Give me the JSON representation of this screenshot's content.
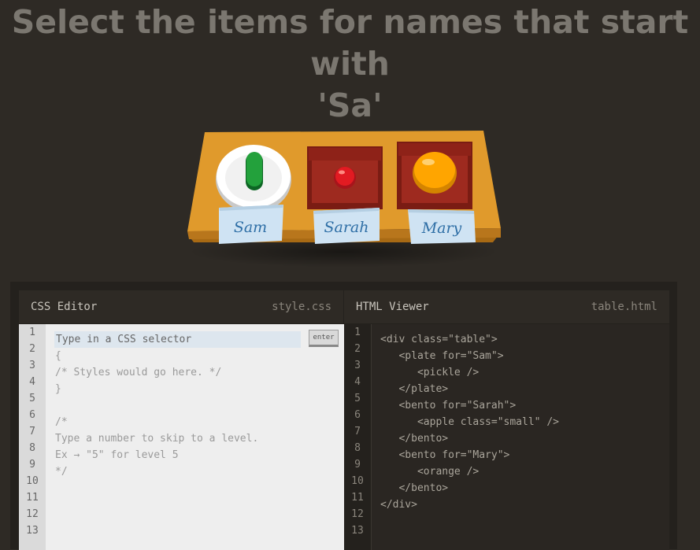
{
  "instruction": {
    "line1": "Select the items for names that start with",
    "line2": "'Sa'"
  },
  "scene": {
    "plates": [
      {
        "owner": "Sam",
        "container": "plate",
        "item": "pickle"
      },
      {
        "owner": "Sarah",
        "container": "bento",
        "item": "apple small"
      },
      {
        "owner": "Mary",
        "container": "bento",
        "item": "orange"
      }
    ],
    "labels": {
      "sam": "Sam",
      "sarah": "Sarah",
      "mary": "Mary"
    }
  },
  "css_editor": {
    "title": "CSS Editor",
    "filename": "style.css",
    "input_placeholder": "Type in a CSS selector",
    "enter_label": "enter",
    "line_numbers": [
      "1",
      "2",
      "3",
      "4",
      "5",
      "6",
      "7",
      "8",
      "9",
      "10",
      "11",
      "12",
      "13"
    ],
    "lines": [
      "",
      "{",
      "/* Styles would go here. */",
      "}",
      "",
      "/*",
      "Type a number to skip to a level.",
      "Ex → \"5\" for level 5",
      "*/",
      "",
      "",
      "",
      ""
    ]
  },
  "html_viewer": {
    "title": "HTML Viewer",
    "filename": "table.html",
    "line_numbers": [
      "1",
      "2",
      "3",
      "4",
      "5",
      "6",
      "7",
      "8",
      "9",
      "10",
      "11",
      "12",
      "13"
    ],
    "lines": [
      "<div class=\"table\">",
      "   <plate for=\"Sam\">",
      "      <pickle />",
      "   </plate>",
      "   <bento for=\"Sarah\">",
      "      <apple class=\"small\" />",
      "   </bento>",
      "   <bento for=\"Mary\">",
      "      <orange />",
      "   </bento>",
      "</div>",
      "",
      ""
    ]
  }
}
